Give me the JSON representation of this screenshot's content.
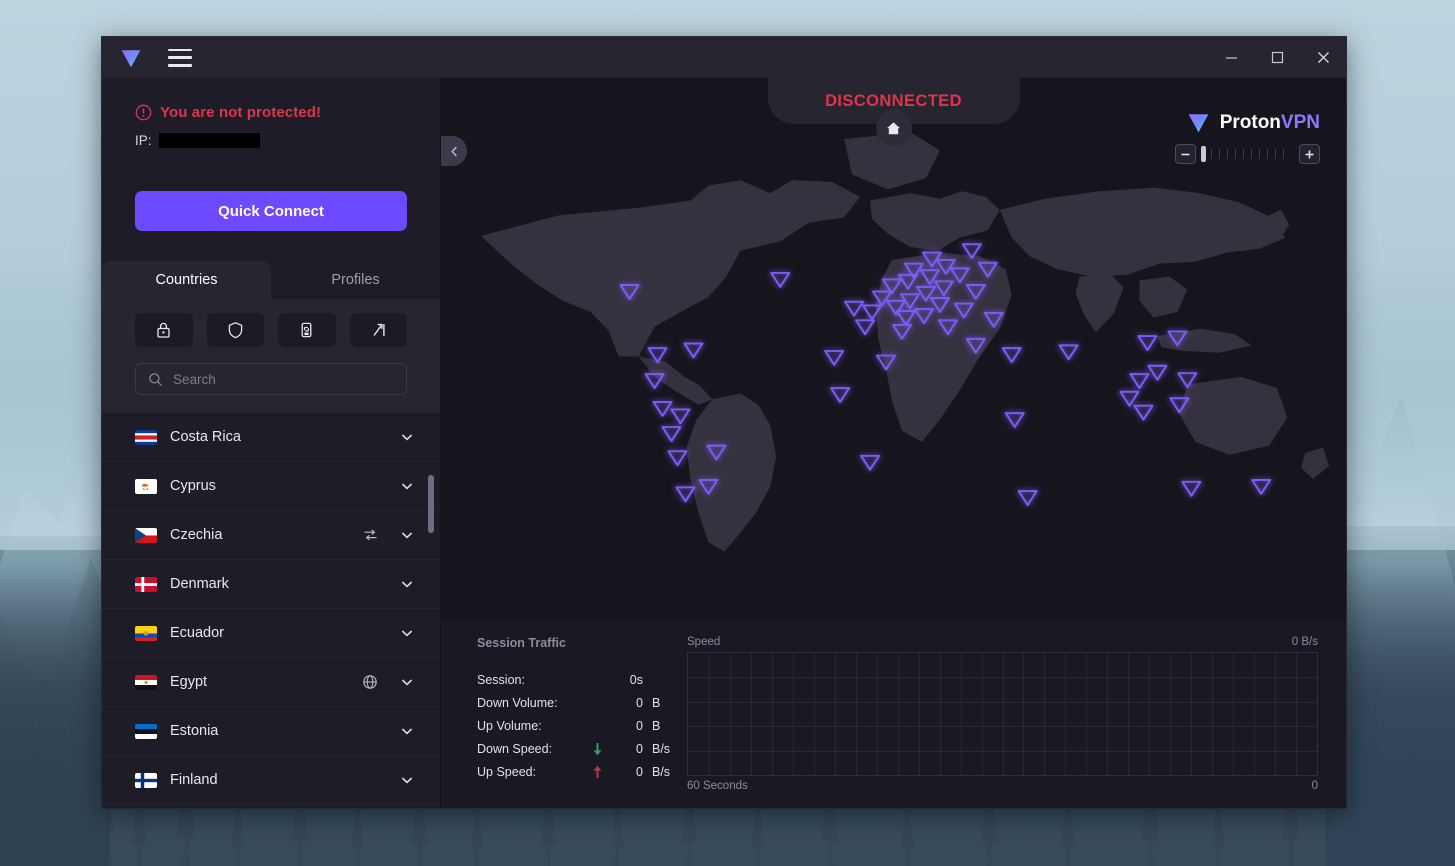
{
  "window": {
    "logo_icon": "protonvpn-logo-icon",
    "menu_icon": "hamburger-menu-icon",
    "minimize_label": "Minimize",
    "maximize_label": "Maximize",
    "close_label": "Close"
  },
  "sidebar": {
    "status": {
      "warning_icon": "alert-circle-icon",
      "warning_text": "You are not protected!",
      "ip_label": "IP:",
      "ip_value": ""
    },
    "quick_connect_label": "Quick Connect",
    "tabs": [
      {
        "label": "Countries",
        "active": true
      },
      {
        "label": "Profiles",
        "active": false
      }
    ],
    "filters": [
      {
        "name": "secure-core-filter",
        "icon": "lock-icon"
      },
      {
        "name": "netshield-filter",
        "icon": "shield-icon"
      },
      {
        "name": "p2p-filter",
        "icon": "p2p-icon"
      },
      {
        "name": "tor-filter",
        "icon": "tor-arrow-icon"
      }
    ],
    "search": {
      "icon": "search-icon",
      "placeholder": "Search",
      "value": ""
    },
    "countries": [
      {
        "name": "Costa Rica",
        "flag": "cr",
        "badge": null
      },
      {
        "name": "Cyprus",
        "flag": "cy",
        "badge": null
      },
      {
        "name": "Czechia",
        "flag": "cz",
        "badge": "p2p-icon"
      },
      {
        "name": "Denmark",
        "flag": "dk",
        "badge": null
      },
      {
        "name": "Ecuador",
        "flag": "ec",
        "badge": null
      },
      {
        "name": "Egypt",
        "flag": "eg",
        "badge": "tor-globe-icon"
      },
      {
        "name": "Estonia",
        "flag": "ee",
        "badge": null
      },
      {
        "name": "Finland",
        "flag": "fi",
        "badge": null
      }
    ],
    "expand_icon": "chevron-down-icon"
  },
  "main": {
    "collapse_icon": "chevron-left-icon",
    "status_text": "DISCONNECTED",
    "status_color": "#e0334d",
    "home_icon": "home-icon",
    "brand": {
      "logo_icon": "protonvpn-logo-icon",
      "name_first": "Proton",
      "name_second": "VPN"
    },
    "zoom": {
      "minus_label": "−",
      "plus_label": "+",
      "level": 0
    },
    "map": {
      "marker_icon": "server-marker-triangle-icon",
      "marker_color": "#7b5cf0",
      "marker_count": 48
    }
  },
  "stats": {
    "session_title": "Session Traffic",
    "rows": [
      {
        "label": "Session:",
        "arrow": null,
        "value": "0",
        "unit": "s",
        "value_inline": "0s"
      },
      {
        "label": "Down Volume:",
        "arrow": null,
        "value": "0",
        "unit": "B"
      },
      {
        "label": "Up Volume:",
        "arrow": null,
        "value": "0",
        "unit": "B"
      },
      {
        "label": "Down Speed:",
        "arrow": "down-arrow-icon",
        "value": "0",
        "unit": "B/s",
        "arrow_color": "#2f9e63"
      },
      {
        "label": "Up Speed:",
        "arrow": "up-arrow-icon",
        "value": "0",
        "unit": "B/s",
        "arrow_color": "#b03a4a"
      }
    ]
  },
  "chart_data": {
    "type": "line",
    "title": "Speed",
    "xlabel": "60 Seconds",
    "ylabel": "",
    "x_axis_left_label": "60 Seconds",
    "x_axis_right_label": "0",
    "y_axis_max_label": "0 B/s",
    "series": [
      {
        "name": "Down Speed",
        "values": [
          0,
          0,
          0,
          0,
          0,
          0,
          0,
          0,
          0,
          0,
          0,
          0,
          0,
          0,
          0,
          0,
          0,
          0,
          0,
          0,
          0,
          0,
          0,
          0,
          0,
          0,
          0,
          0,
          0,
          0
        ],
        "color": "#2f9e63"
      },
      {
        "name": "Up Speed",
        "values": [
          0,
          0,
          0,
          0,
          0,
          0,
          0,
          0,
          0,
          0,
          0,
          0,
          0,
          0,
          0,
          0,
          0,
          0,
          0,
          0,
          0,
          0,
          0,
          0,
          0,
          0,
          0,
          0,
          0,
          0
        ],
        "color": "#b03a4a"
      }
    ],
    "ylim": [
      0,
      0
    ],
    "grid": true,
    "grid_columns": 30,
    "grid_rows": 5,
    "legend": "none"
  }
}
